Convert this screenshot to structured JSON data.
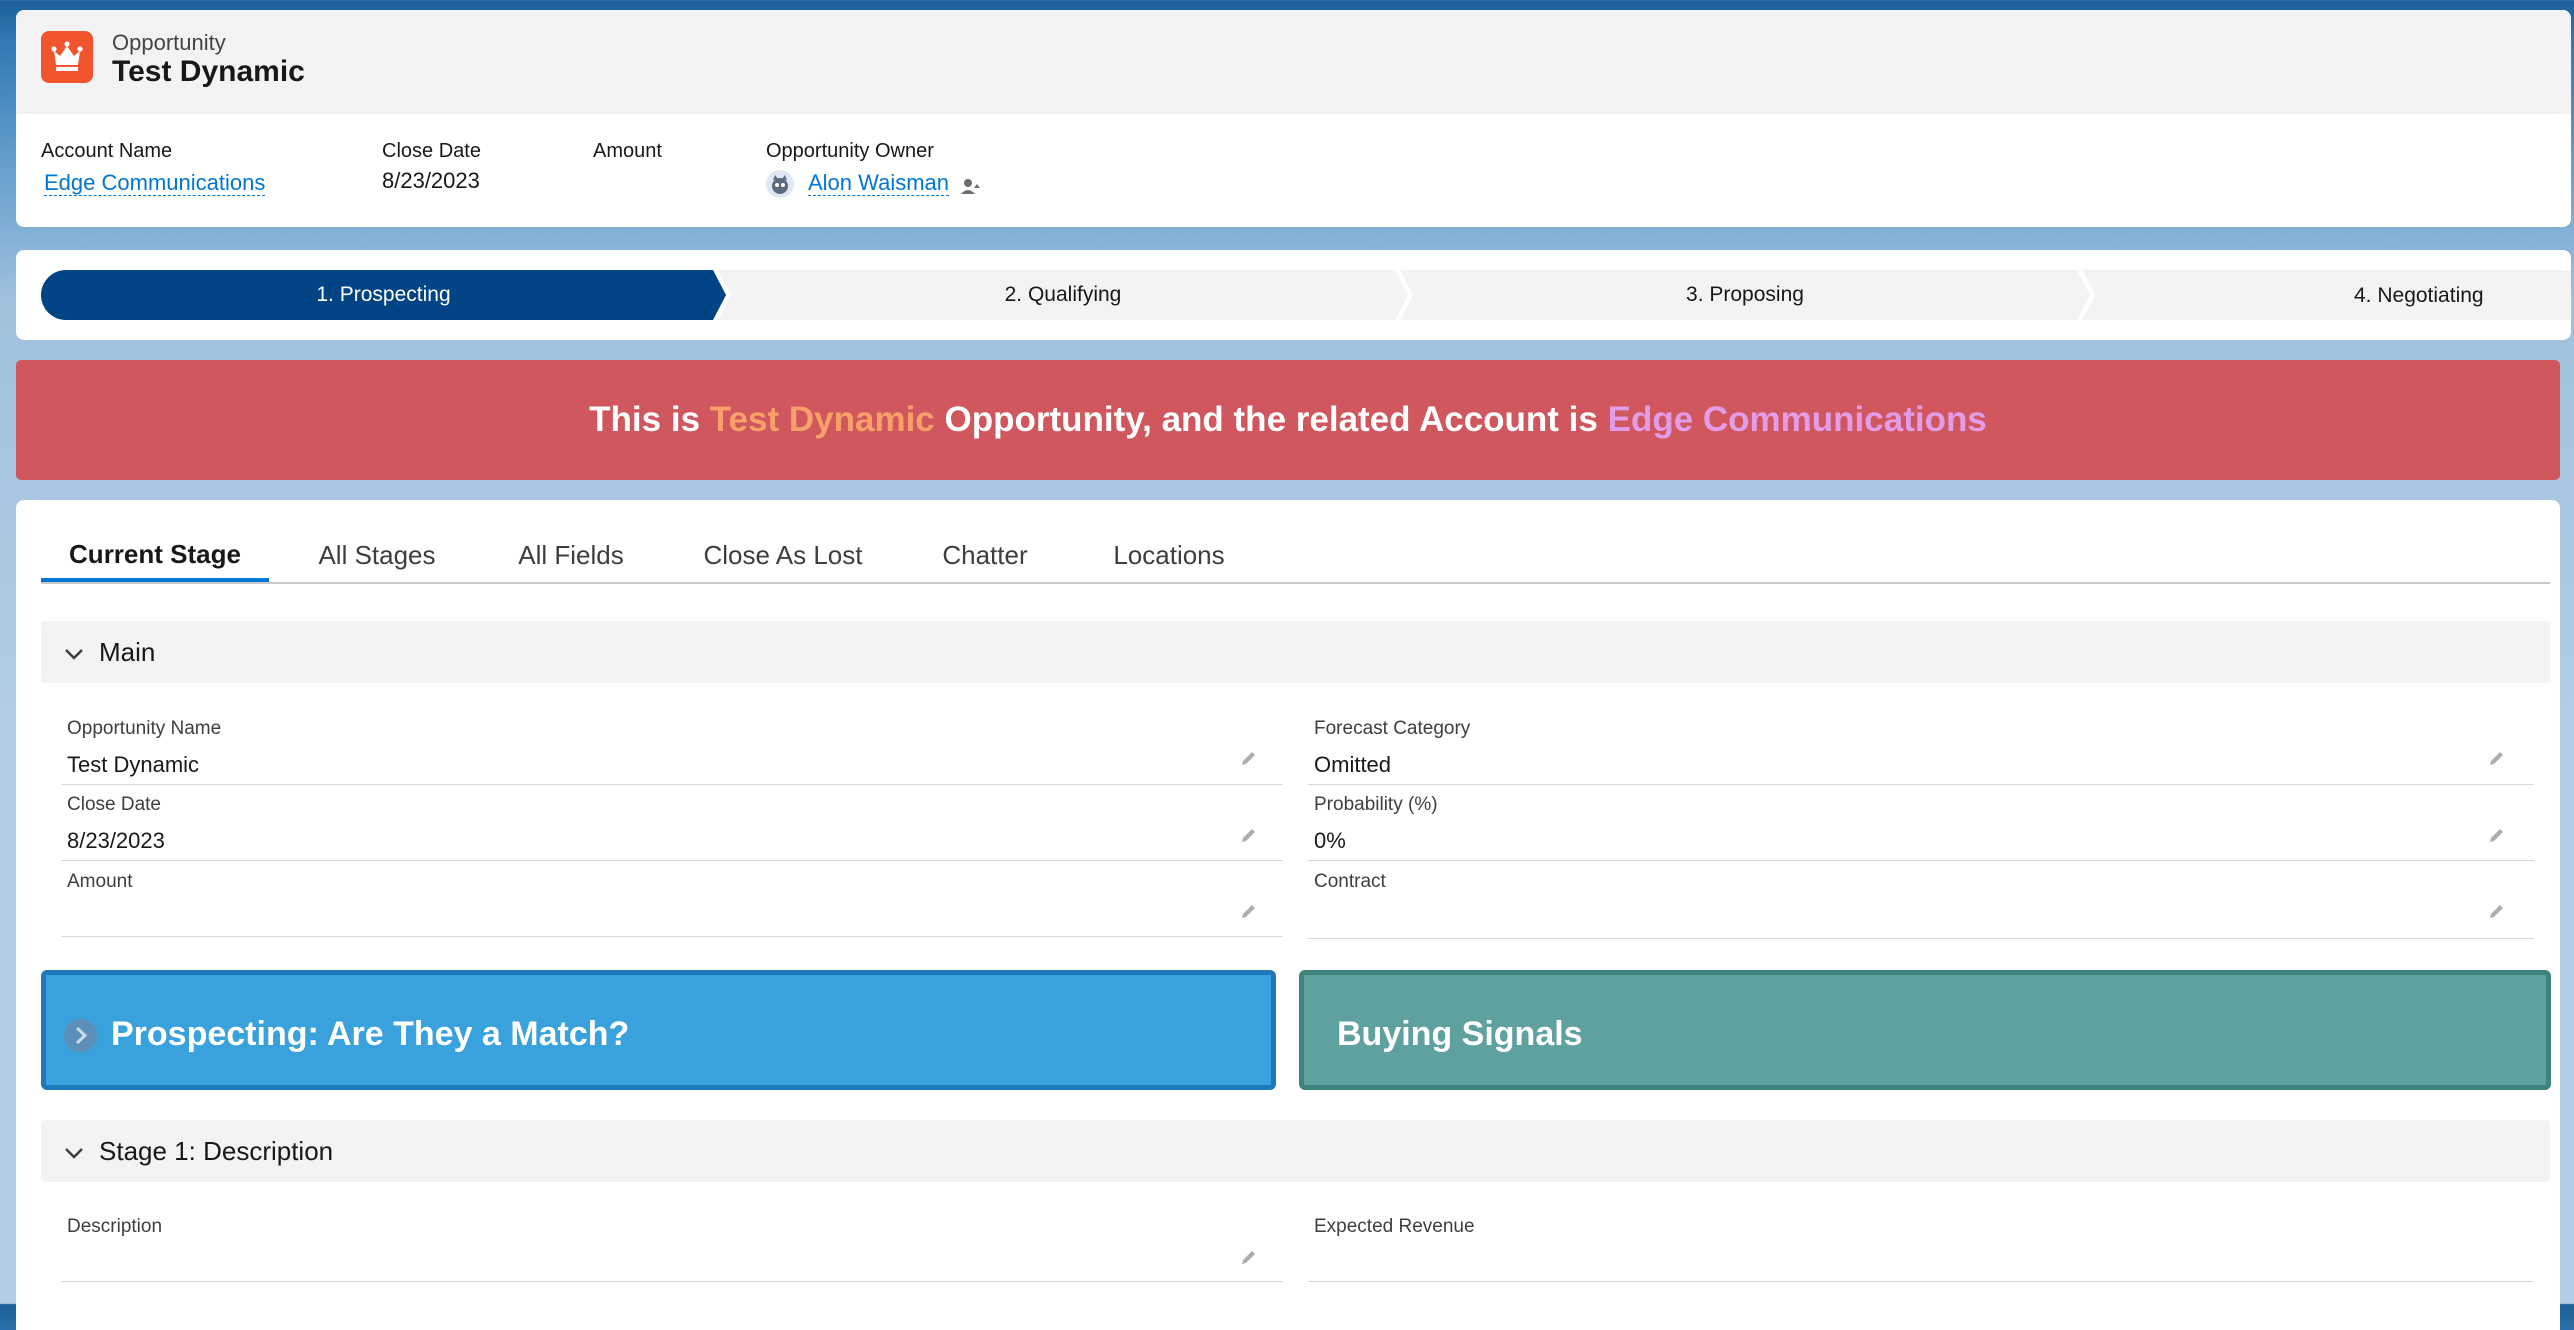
{
  "header": {
    "object_type": "Opportunity",
    "record_title": "Test Dynamic",
    "fields": {
      "account_name_label": "Account Name",
      "account_name_value": "Edge Communications",
      "close_date_label": "Close Date",
      "close_date_value": "8/23/2023",
      "amount_label": "Amount",
      "owner_label": "Opportunity Owner",
      "owner_value": "Alon Waisman"
    },
    "icons": {
      "object": "opportunity-crown-icon",
      "owner_avatar": "user-avatar-icon",
      "change_owner": "change-owner-icon"
    }
  },
  "path": {
    "stages": [
      {
        "label": "1. Prospecting",
        "active": true
      },
      {
        "label": "2. Qualifying",
        "active": false
      },
      {
        "label": "3. Proposing",
        "active": false
      },
      {
        "label": "4. Negotiating",
        "active": false
      }
    ]
  },
  "banner": {
    "part1": "This is ",
    "opportunity_name": "Test Dynamic",
    "part2": " Opportunity, and the related Account is ",
    "account_name": "Edge Communications"
  },
  "tabs": [
    "Current Stage",
    "All Stages",
    "All Fields",
    "Close As Lost",
    "Chatter",
    "Locations"
  ],
  "active_tab": "Current Stage",
  "sections": {
    "main": {
      "title": "Main",
      "fields": {
        "opportunity_name_label": "Opportunity Name",
        "opportunity_name_value": "Test Dynamic",
        "close_date_label": "Close Date",
        "close_date_value": "8/23/2023",
        "amount_label": "Amount",
        "amount_value": "",
        "forecast_category_label": "Forecast Category",
        "forecast_category_value": "Omitted",
        "probability_label": "Probability (%)",
        "probability_value": "0%",
        "contract_label": "Contract",
        "contract_value": ""
      }
    },
    "rich_cards": {
      "prospecting_title": "Prospecting: Are They a Match?",
      "buying_signals_title": "Buying Signals"
    },
    "stage1": {
      "title": "Stage 1: Description",
      "fields": {
        "description_label": "Description",
        "description_value": "",
        "expected_revenue_label": "Expected Revenue",
        "expected_revenue_value": ""
      }
    }
  },
  "colors": {
    "brand_blue": "#0176d3",
    "path_active": "#014486",
    "path_inactive": "#f3f3f3",
    "banner_bg": "#d0575d",
    "banner_highlight_1": "#f8a06a",
    "banner_highlight_2": "#e29ce8",
    "prospecting_card": "#39a2dc",
    "buying_signals_card": "#5ea19e",
    "object_icon": "#f2542d"
  }
}
